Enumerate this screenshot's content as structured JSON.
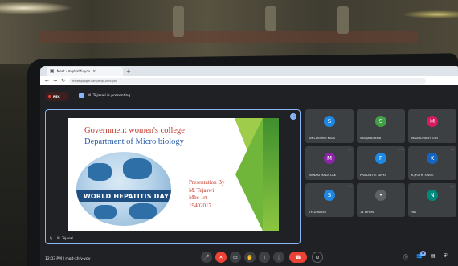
{
  "browser": {
    "tab_title": "Meet - mqd-xhfv-yov",
    "url": "meet.google.com/mqd-xhfv-yov"
  },
  "meet": {
    "rec_label": "REC",
    "presenting_label": "M. Tejaswi is presenting",
    "main_tile_name": "M. Tejaswi",
    "footer_time": "12:03 PM",
    "footer_code": "mqd-xhfv-yov"
  },
  "slide": {
    "title_line1": "Government women's college",
    "title_line2": "Department of Micro biology",
    "banner": "WORLD HEPATITIS DAY",
    "presenter_lines": [
      "Presentation By",
      "M. Tejaswi",
      "Mbc 1rt",
      "19402017"
    ]
  },
  "participants": [
    {
      "initial": "S",
      "name": "SM LAKSHMI KALA",
      "color": "#1e88e5"
    },
    {
      "initial": "S",
      "name": "Sailaja Buttala",
      "color": "#43a047"
    },
    {
      "initial": "M",
      "name": "MADHUMATHI GHT",
      "color": "#d81b60"
    },
    {
      "initial": "M",
      "name": "MANASI MADA LAK",
      "color": "#8e24aa"
    },
    {
      "initial": "P",
      "name": "PRASANTHI KAVYA",
      "color": "#1e88e5"
    },
    {
      "initial": "K",
      "name": "K.JYOTHI SWEO",
      "color": "#1565c0"
    },
    {
      "initial": "S",
      "name": "SYED RAJIYA",
      "color": "#1e88e5"
    },
    {
      "initial": "",
      "name": "14 others",
      "color": "#5f6368"
    },
    {
      "initial": "N",
      "name": "You",
      "color": "#00897b"
    }
  ],
  "controls": {
    "mic_icon": "mic-icon",
    "cam_icon": "camera-icon",
    "cc_icon": "captions-icon",
    "hand_icon": "raise-hand-icon",
    "present_icon": "present-icon",
    "more_icon": "more-icon",
    "end_icon": "end-call-icon"
  }
}
